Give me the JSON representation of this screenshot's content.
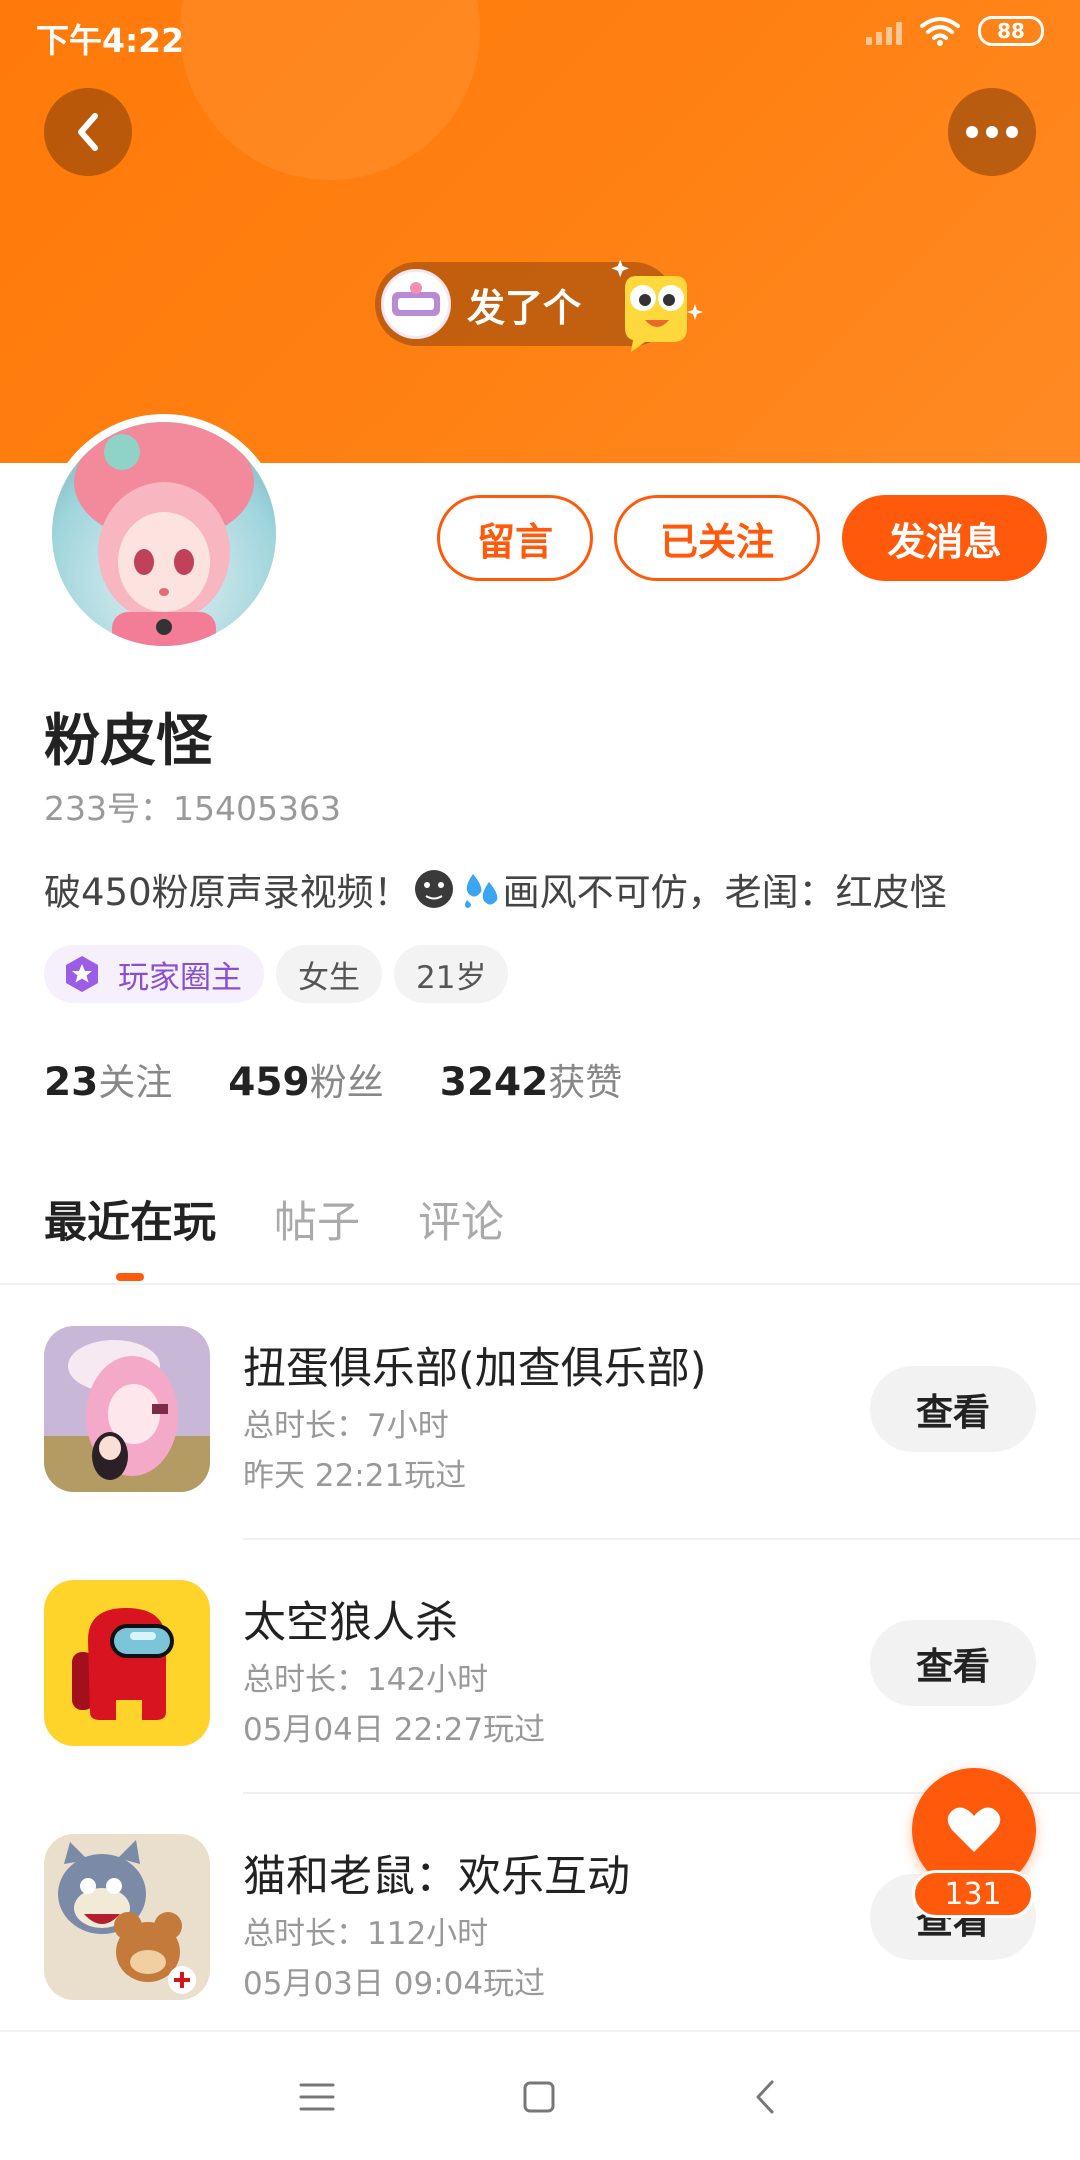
{
  "status_bar": {
    "time": "下午4:22",
    "battery": "88"
  },
  "header": {
    "activity_text": "发了个",
    "theme_color": "#ff7a0a",
    "accent_color": "#ff5a0c"
  },
  "profile": {
    "actions": {
      "message_label": "留言",
      "follow_label": "已关注",
      "send_label": "发消息"
    },
    "nickname": "粉皮怪",
    "uid_label": "233号：15405363",
    "bio_part1": "破450粉原声录视频！",
    "bio_part2": "画风不可仿，老闺：红皮怪",
    "tags": {
      "owner": "玩家圈主",
      "gender": "女生",
      "age": "21岁"
    },
    "stats": {
      "following_count": "23",
      "following_label": "关注",
      "fans_count": "459",
      "fans_label": "粉丝",
      "likes_count": "3242",
      "likes_label": "获赞"
    }
  },
  "tabs": [
    "最近在玩",
    "帖子",
    "评论"
  ],
  "games": [
    {
      "title": "扭蛋俱乐部(加查俱乐部)",
      "duration": "总时长：7小时",
      "last_played": "昨天 22:21玩过",
      "view_label": "查看",
      "icon": "gacha-club-icon"
    },
    {
      "title": "太空狼人杀",
      "duration": "总时长：142小时",
      "last_played": "05月04日 22:27玩过",
      "view_label": "查看",
      "icon": "among-us-icon"
    },
    {
      "title": "猫和老鼠：欢乐互动",
      "duration": "总时长：112小时",
      "last_played": "05月03日 09:04玩过",
      "view_label": "查看",
      "icon": "tom-and-jerry-icon"
    }
  ],
  "like_fab": {
    "count": "131"
  }
}
